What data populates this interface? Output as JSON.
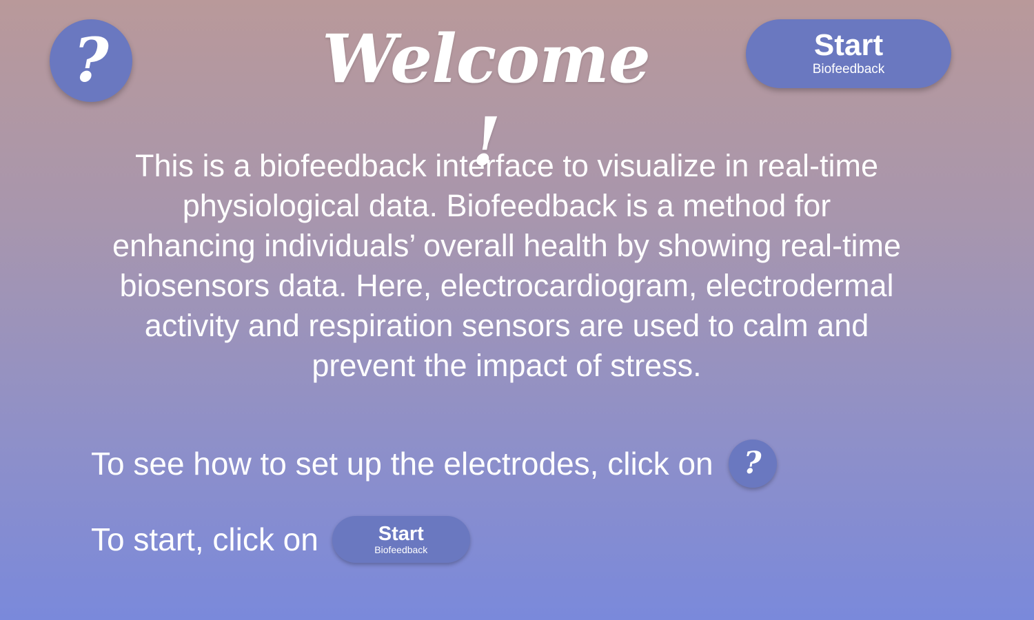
{
  "header": {
    "help_button": {
      "glyph": "?",
      "icon": "question-mark-icon"
    },
    "title": "Welcome !",
    "start_button": {
      "label": "Start",
      "sublabel": "Biofeedback"
    }
  },
  "main": {
    "description": "This is a biofeedback interface to visualize in real-time physiological data. Biofeedback is a method for enhancing individuals’ overall health by showing real-time biosensors data. Here, electrocardiogram, electrodermal activity and respiration sensors are used to calm and prevent the impact of stress.",
    "electrodes_instruction": "To see how to set up the electrodes, click on",
    "electrodes_help_button": {
      "glyph": "?",
      "icon": "question-mark-icon"
    },
    "start_instruction": "To start, click on",
    "start_button": {
      "label": "Start",
      "sublabel": "Biofeedback"
    }
  },
  "colors": {
    "button_bg": "#6a78c0",
    "gradient_top": "#b9999a",
    "gradient_bottom": "#7a89db",
    "text": "#ffffff"
  }
}
